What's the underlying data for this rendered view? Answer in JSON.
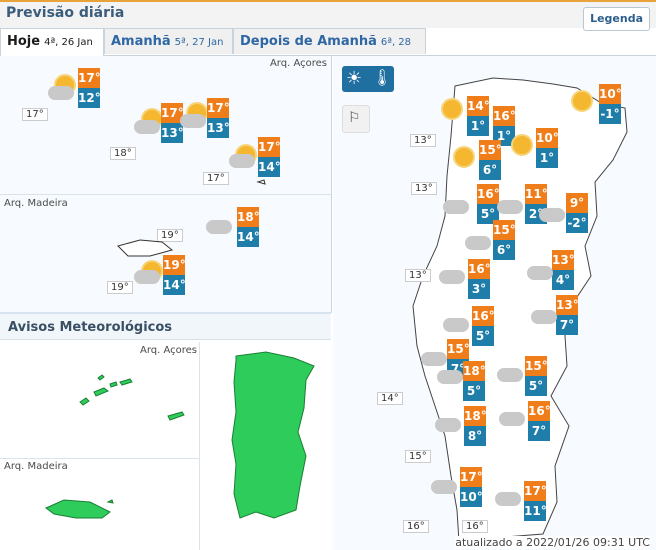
{
  "header": {
    "title": "Previsão diária",
    "legend_label": "Legenda"
  },
  "tabs": [
    {
      "label": "Hoje",
      "sub": "4ª, 26 Jan",
      "active": true
    },
    {
      "label": "Amanhã",
      "sub": "5ª, 27 Jan",
      "active": false
    },
    {
      "label": "Depois de Amanhã",
      "sub": "6ª, 28 Jan",
      "active": false
    }
  ],
  "islands": {
    "acores_label": "Arq. Açores",
    "madeira_label": "Arq. Madeira",
    "sea_temps": [
      "17°",
      "18°",
      "17°",
      "19°",
      "19°"
    ],
    "stations": [
      {
        "max": "17°",
        "min": "12°"
      },
      {
        "max": "17°",
        "min": "13°"
      },
      {
        "max": "17°",
        "min": "13°"
      },
      {
        "max": "17°",
        "min": "14°"
      },
      {
        "max": "18°",
        "min": "14°"
      },
      {
        "max": "19°",
        "min": "14°"
      }
    ]
  },
  "avisos": {
    "title": "Avisos Meteorológicos",
    "acores_label": "Arq. Açores",
    "madeira_label": "Arq. Madeira",
    "colors": {
      "green": "#2ecc5a",
      "border": "#1a7f35"
    }
  },
  "mainland": {
    "sea_temps": [
      "13°",
      "13°",
      "13°",
      "14°",
      "15°",
      "16°",
      "16°"
    ],
    "stations": [
      {
        "max": "14°",
        "min": "1°"
      },
      {
        "max": "16°",
        "min": "1°"
      },
      {
        "max": "10°",
        "min": "-1°"
      },
      {
        "max": "10°",
        "min": "1°"
      },
      {
        "max": "15°",
        "min": "6°"
      },
      {
        "max": "16°",
        "min": "5°"
      },
      {
        "max": "11°",
        "min": "2°"
      },
      {
        "max": "9°",
        "min": "-2°"
      },
      {
        "max": "15°",
        "min": "6°"
      },
      {
        "max": "16°",
        "min": "3°"
      },
      {
        "max": "13°",
        "min": "4°"
      },
      {
        "max": "16°",
        "min": "5°"
      },
      {
        "max": "13°",
        "min": "7°"
      },
      {
        "max": "15°",
        "min": "7°"
      },
      {
        "max": "18°",
        "min": "5°"
      },
      {
        "max": "15°",
        "min": "5°"
      },
      {
        "max": "18°",
        "min": "8°"
      },
      {
        "max": "16°",
        "min": "7°"
      },
      {
        "max": "17°",
        "min": "10°"
      },
      {
        "max": "17°",
        "min": "11°"
      }
    ]
  },
  "footer": {
    "updated": "atualizado a 2022/01/26 09:31 UTC"
  },
  "colors": {
    "max_bg": "#ef7d1a",
    "min_bg": "#1f7ea9",
    "accent": "#e8a33a"
  }
}
